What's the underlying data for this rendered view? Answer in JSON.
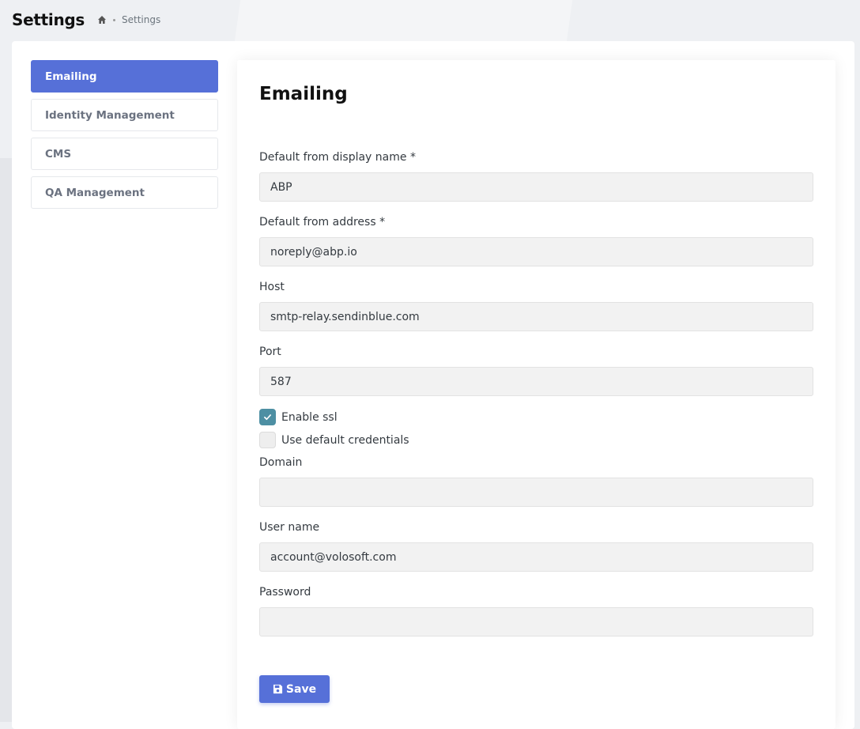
{
  "header": {
    "title": "Settings",
    "breadcrumb": {
      "home_icon": "home-icon",
      "current": "Settings"
    }
  },
  "nav": {
    "items": [
      {
        "label": "Emailing",
        "active": true
      },
      {
        "label": "Identity Management",
        "active": false
      },
      {
        "label": "CMS",
        "active": false
      },
      {
        "label": "QA Management",
        "active": false
      }
    ]
  },
  "panel": {
    "title": "Emailing",
    "fields": {
      "display_name": {
        "label": "Default from display name *",
        "value": "ABP"
      },
      "from_address": {
        "label": "Default from address *",
        "value": "noreply@abp.io"
      },
      "host": {
        "label": "Host",
        "value": "smtp-relay.sendinblue.com"
      },
      "port": {
        "label": "Port",
        "value": "587"
      },
      "domain": {
        "label": "Domain",
        "value": ""
      },
      "user_name": {
        "label": "User name",
        "value": "account@volosoft.com"
      },
      "password": {
        "label": "Password",
        "value": ""
      }
    },
    "checkboxes": {
      "enable_ssl": {
        "label": "Enable ssl",
        "checked": true
      },
      "use_default_credentials": {
        "label": "Use default credentials",
        "checked": false
      }
    },
    "save_label": "Save"
  },
  "colors": {
    "primary": "#5670d8",
    "checkbox_checked": "#4d8fa3",
    "input_bg": "#f2f2f2"
  }
}
